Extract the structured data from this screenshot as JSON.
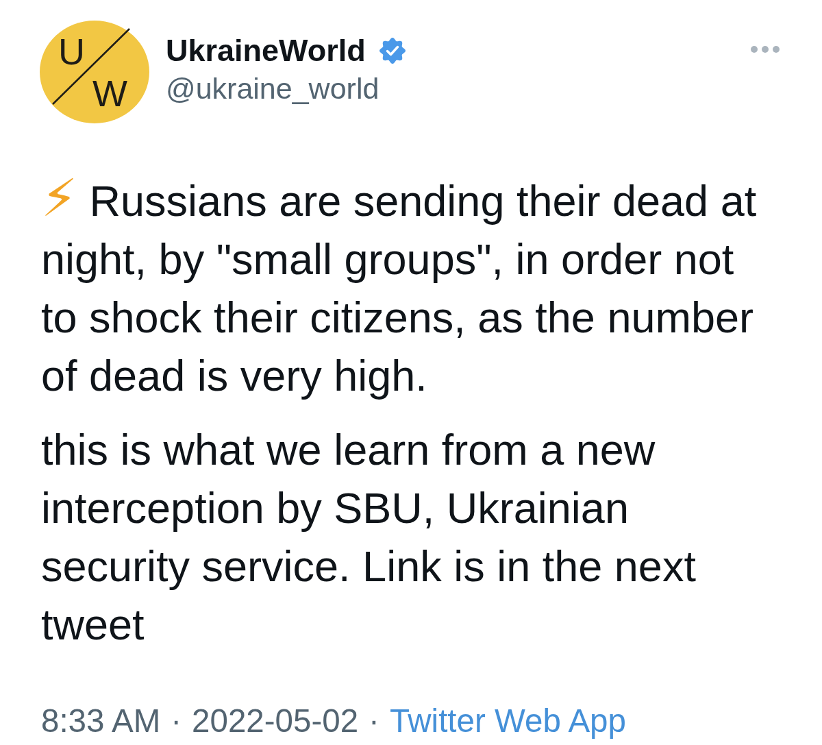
{
  "author": {
    "avatar": {
      "letters": [
        "U",
        "W"
      ]
    },
    "name": "UkraineWorld",
    "verified": true,
    "handle": "@ukraine_world"
  },
  "tweet": {
    "paragraphs": [
      {
        "kind": "emoji",
        "text": "⚡ Russians are sending their dead at night, by \"small groups\", in order not to shock their citizens, as the number of dead is very high."
      },
      {
        "kind": "plain",
        "text": "this is what we learn from a new interception by SBU, Ukrainian security service. Link is in the next tweet"
      }
    ]
  },
  "meta": [
    {
      "kind": "text",
      "text": "8:33 AM"
    },
    {
      "kind": "separator",
      "text": "·"
    },
    {
      "kind": "text",
      "text": "2022-05-02"
    },
    {
      "kind": "separator",
      "text": "·"
    },
    {
      "kind": "link",
      "text": "Twitter Web App"
    }
  ]
}
